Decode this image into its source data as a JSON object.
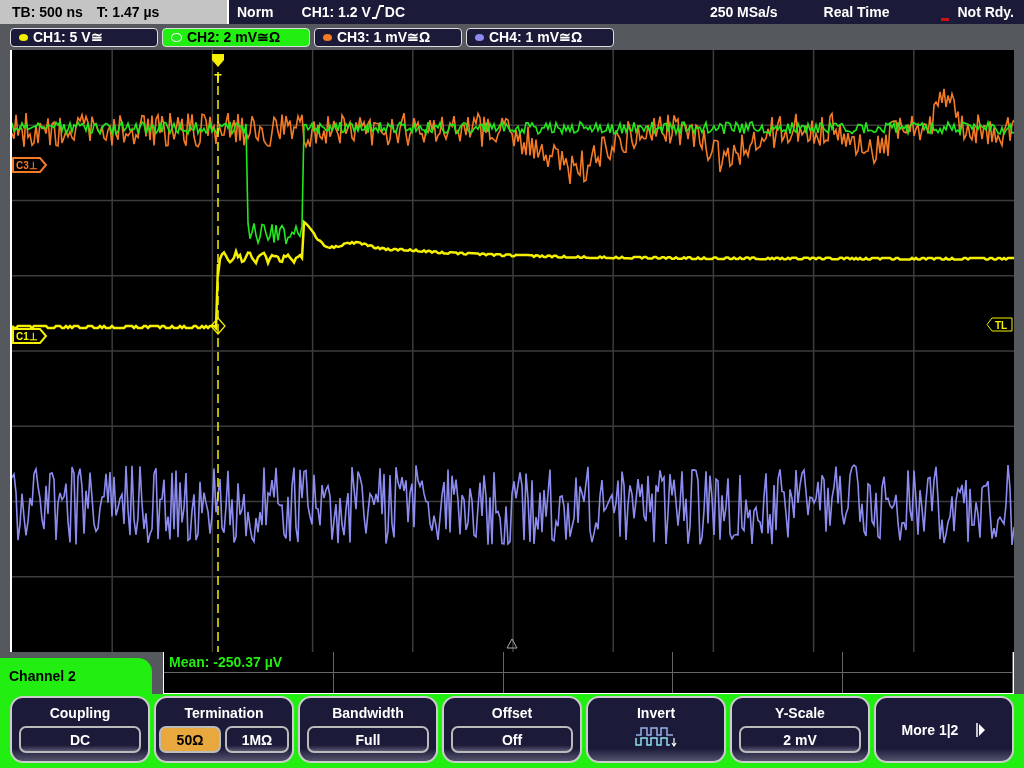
{
  "status_bar": {
    "timebase": "TB: 500 ns",
    "trigger_time": "T: 1.47 µs",
    "mode": "Norm",
    "trigger_source": "CH1: 1.2 V",
    "trigger_coupling": "DC",
    "sample_rate": "250 MSa/s",
    "acquisition": "Real Time",
    "state": "Not Rdy."
  },
  "channels": [
    {
      "label": "CH1: 5 V≅",
      "color": "#f5f000",
      "selected": false
    },
    {
      "label": "CH2: 2 mV≅Ω",
      "color": "#22e81c",
      "selected": true
    },
    {
      "label": "CH3: 1 mV≅Ω",
      "color": "#f57a26",
      "selected": false
    },
    {
      "label": "CH4: 1 mV≅Ω",
      "color": "#8c8cf0",
      "selected": false
    }
  ],
  "plot": {
    "trigger_position": "T",
    "trigger_level": "TL",
    "markers": [
      {
        "text": "C3⊥",
        "color": "#f57a26"
      },
      {
        "text": "C1⊥",
        "color": "#f5f000"
      }
    ]
  },
  "measurement": "Mean: -250.37 µV",
  "menu": {
    "title": "Channel 2",
    "softkeys": [
      {
        "kind": "button",
        "label": "Coupling",
        "value": "DC"
      },
      {
        "kind": "toggle",
        "label": "Termination",
        "options": [
          {
            "text": "50Ω",
            "selected": true
          },
          {
            "text": "1MΩ",
            "selected": false
          }
        ]
      },
      {
        "kind": "button",
        "label": "Bandwidth",
        "value": "Full"
      },
      {
        "kind": "button",
        "label": "Offset",
        "value": "Off"
      },
      {
        "kind": "icon",
        "label": "Invert"
      },
      {
        "kind": "button",
        "label": "Y-Scale",
        "value": "2 mV"
      },
      {
        "kind": "more",
        "label": "More 1|2"
      }
    ]
  }
}
